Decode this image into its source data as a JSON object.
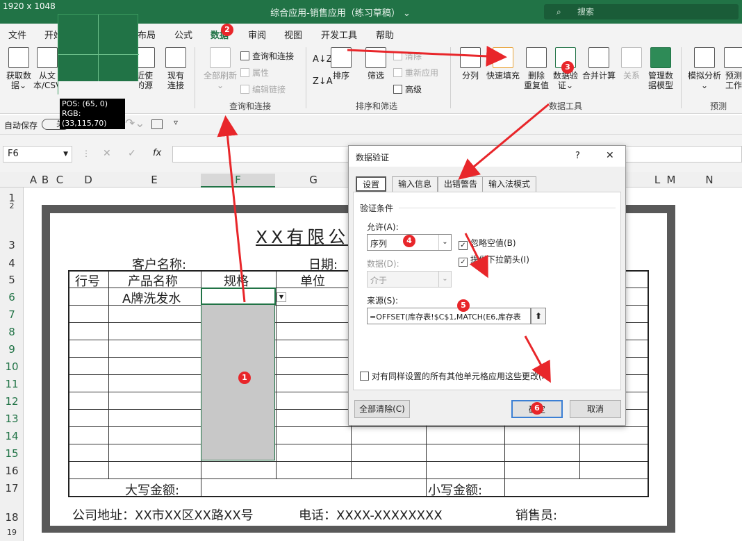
{
  "window": {
    "size_label": "1920 x 1048",
    "title": "综合应用-销售应用（练习草稿）",
    "title_caret": "⌄",
    "search_placeholder": "搜索"
  },
  "menu": [
    "文件",
    "开始",
    "布局",
    "公式",
    "数据",
    "审阅",
    "视图",
    "开发工具",
    "帮助"
  ],
  "ribbon": {
    "get_data": "获取数\n据⌄",
    "from_text": "从文\n本/CSV",
    "recent_sources": "近使\n的源",
    "existing_conn": "现有\n连接",
    "refresh_all": "全部刷新\n⌄",
    "queries_conn": "查询和连接",
    "properties": "属性",
    "edit_links": "编辑链接",
    "group_query": "查询和连接",
    "sort": "排序",
    "filter": "筛选",
    "clear": "清除",
    "reapply": "重新应用",
    "advanced": "高级",
    "group_sort": "排序和筛选",
    "text_to_columns": "分列",
    "flash_fill": "快速填充",
    "remove_dup": "删除\n重复值",
    "data_validation": "数据验\n证⌄",
    "consolidate": "合并计算",
    "relationships": "关系",
    "manage_model": "管理数\n据模型",
    "group_tools": "数据工具",
    "what_if": "模拟分析\n⌄",
    "forecast": "预测\n工作",
    "group_forecast": "预测",
    "get_data_group": "数据"
  },
  "qat": {
    "autosave": "自动保存",
    "toggle": "关"
  },
  "formula": {
    "namebox": "F6",
    "fx": "fx",
    "cancel": "✕",
    "enter": "✓"
  },
  "columns": [
    "A",
    "B",
    "C",
    "D",
    "E",
    "F",
    "G",
    "L",
    "M",
    "N"
  ],
  "rows": [
    "1",
    "2",
    "3",
    "4",
    "5",
    "6",
    "7",
    "8",
    "9",
    "10",
    "11",
    "12",
    "13",
    "14",
    "15",
    "16",
    "17",
    "18",
    "19"
  ],
  "form": {
    "company": "XX有限公",
    "customer_label": "客户名称:",
    "date_label": "日期:",
    "headers": [
      "行号",
      "产品名称",
      "规格",
      "单位"
    ],
    "r6_product": "A牌洗发水",
    "big_amount": "大写金额:",
    "small_amount": "小写金额:",
    "address": "公司地址：XX市XX区XX路XX号",
    "phone": "电话：XXXX-XXXXXXXX",
    "salesperson": "销售员:"
  },
  "zoom": {
    "pos": "POS: (65, 0)",
    "rgb": "RGB: (33,115,70)"
  },
  "dialog": {
    "title": "数据验证",
    "help": "?",
    "close": "✕",
    "tabs": [
      "设置",
      "输入信息",
      "出错警告",
      "输入法模式"
    ],
    "section": "验证条件",
    "allow_label": "允许(A):",
    "allow_value": "序列",
    "ignore_blank": "忽略空值(B)",
    "dropdown": "提供下拉箭头(I)",
    "data_label": "数据(D):",
    "data_value": "介于",
    "source_label": "来源(S):",
    "source_value": "=OFFSET(库存表!$C$1,MATCH(E6,库存表",
    "apply_all": "对有同样设置的所有其他单元格应用这些更改(P)",
    "clear_all": "全部清除(C)",
    "ok": "确定",
    "cancel": "取消"
  },
  "badges": [
    "1",
    "2",
    "3",
    "4",
    "5",
    "6"
  ],
  "colors": {
    "excel_green": "#217346",
    "badge_red": "#e8262a",
    "arrow_red": "#e8262a"
  }
}
